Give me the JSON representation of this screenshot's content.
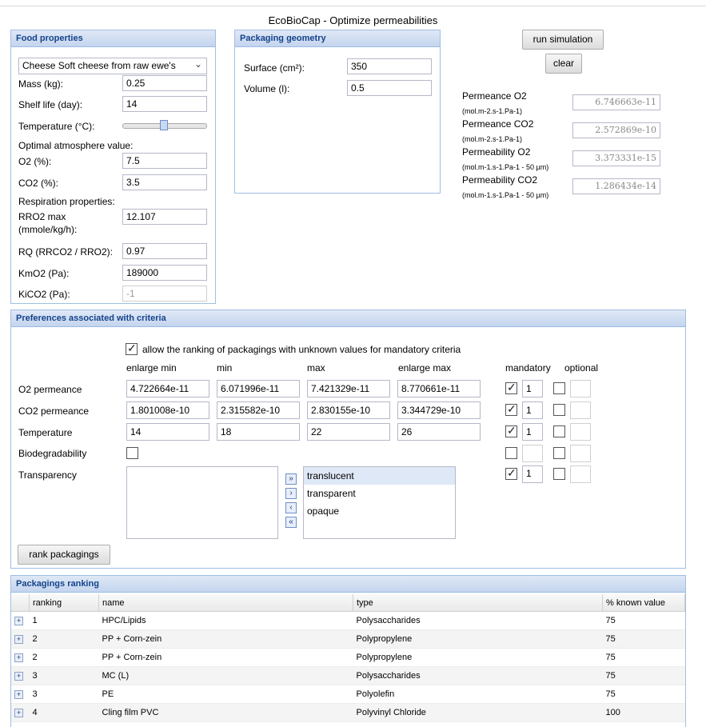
{
  "app_title": "EcoBioCap - Optimize permeabilities",
  "food": {
    "panel_title": "Food properties",
    "food_select": "Cheese Soft cheese from raw ewe's",
    "mass_label": "Mass (kg):",
    "mass": "0.25",
    "shelf_label": "Shelf life (day):",
    "shelf": "14",
    "temp_label": "Temperature (°C):",
    "temp_value": 0.5,
    "optimal_label": "Optimal atmosphere value:",
    "o2_label": "O2 (%):",
    "o2": "7.5",
    "co2_label": "CO2 (%):",
    "co2": "3.5",
    "resp_label": "Respiration properties:",
    "rro2_label_1": "RRO2 max",
    "rro2_label_2": "(mmole/kg/h):",
    "rro2": "12.107",
    "rq_label": "RQ (RRCO2 / RRO2):",
    "rq": "0.97",
    "kmo2_label": "KmO2 (Pa):",
    "kmo2": "189000",
    "kico2_label": "KiCO2 (Pa):",
    "kico2": "-1"
  },
  "geometry": {
    "panel_title": "Packaging geometry",
    "surface_label": "Surface (cm²):",
    "surface": "350",
    "volume_label": "Volume (l):",
    "volume": "0.5"
  },
  "actions": {
    "run": "run simulation",
    "clear": "clear"
  },
  "results": [
    {
      "label": "Permeance O2",
      "unit": "(mol.m-2.s-1.Pa-1)",
      "value": "6.746663e-11"
    },
    {
      "label": "Permeance CO2",
      "unit": "(mol.m-2.s-1.Pa-1)",
      "value": "2.572869e-10"
    },
    {
      "label": "Permeability O2",
      "unit": "(mol.m-1.s-1.Pa-1 - 50 µm)",
      "value": "3.373331e-15"
    },
    {
      "label": "Permeability CO2",
      "unit": "(mol.m-1.s-1.Pa-1 - 50 µm)",
      "value": "1.286434e-14"
    }
  ],
  "prefs": {
    "panel_title": "Preferences associated with criteria",
    "allow_label": "allow the ranking of packagings with unknown values for mandatory criteria",
    "headers": {
      "enlarge_min": "enlarge min",
      "min": "min",
      "max": "max",
      "enlarge_max": "enlarge max",
      "mandatory": "mandatory",
      "optional": "optional"
    },
    "rows": [
      {
        "label": "O2 permeance",
        "enlarge_min": "4.722664e-11",
        "min": "6.071996e-11",
        "max": "7.421329e-11",
        "enlarge_max": "8.770661e-11",
        "mandatory_weight": "1"
      },
      {
        "label": "CO2 permeance",
        "enlarge_min": "1.801008e-10",
        "min": "2.315582e-10",
        "max": "2.830155e-10",
        "enlarge_max": "3.344729e-10",
        "mandatory_weight": "1"
      },
      {
        "label": "Temperature",
        "enlarge_min": "14",
        "min": "18",
        "max": "22",
        "enlarge_max": "26",
        "mandatory_weight": "1"
      }
    ],
    "biodeg_label": "Biodegradability",
    "transparency_label": "Transparency",
    "transparency_weight": "1",
    "transparency_options": [
      "translucent",
      "transparent",
      "opaque"
    ],
    "rank_button": "rank packagings"
  },
  "ranking": {
    "panel_title": "Packagings ranking",
    "columns": [
      "ranking",
      "name",
      "type",
      "% known value"
    ],
    "rows": [
      {
        "rank": "1",
        "name": "HPC/Lipids",
        "type": "Polysaccharides",
        "known": "75"
      },
      {
        "rank": "2",
        "name": "PP + Corn-zein",
        "type": "Polypropylene",
        "known": "75"
      },
      {
        "rank": "2",
        "name": "PP + Corn-zein",
        "type": "Polypropylene",
        "known": "75"
      },
      {
        "rank": "3",
        "name": "MC (L)",
        "type": "Polysaccharides",
        "known": "75"
      },
      {
        "rank": "3",
        "name": "PE",
        "type": "Polyolefin",
        "known": "75"
      },
      {
        "rank": "4",
        "name": "Cling film PVC",
        "type": "Polyvinyl Chloride",
        "known": "100"
      }
    ]
  }
}
